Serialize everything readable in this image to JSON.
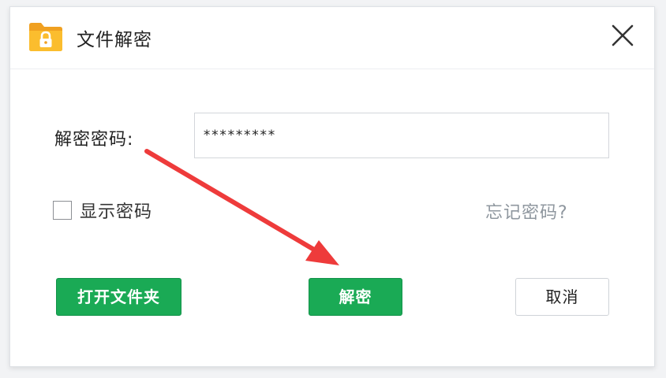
{
  "window": {
    "title": "文件解密",
    "app_icon": "lock-folder-icon",
    "close_icon": "close-icon"
  },
  "form": {
    "password_label": "解密密码:",
    "password_value": "*********",
    "show_password_label": "显示密码",
    "show_password_checked": false,
    "forgot_password_link": "忘记密码?"
  },
  "buttons": {
    "open_folder": "打开文件夹",
    "decrypt": "解密",
    "cancel": "取消"
  },
  "annotation": {
    "arrow_color": "#ee3b3b"
  },
  "colors": {
    "primary_green": "#1aaa55",
    "link_gray": "#8f979f",
    "folder_orange": "#f5a623"
  }
}
